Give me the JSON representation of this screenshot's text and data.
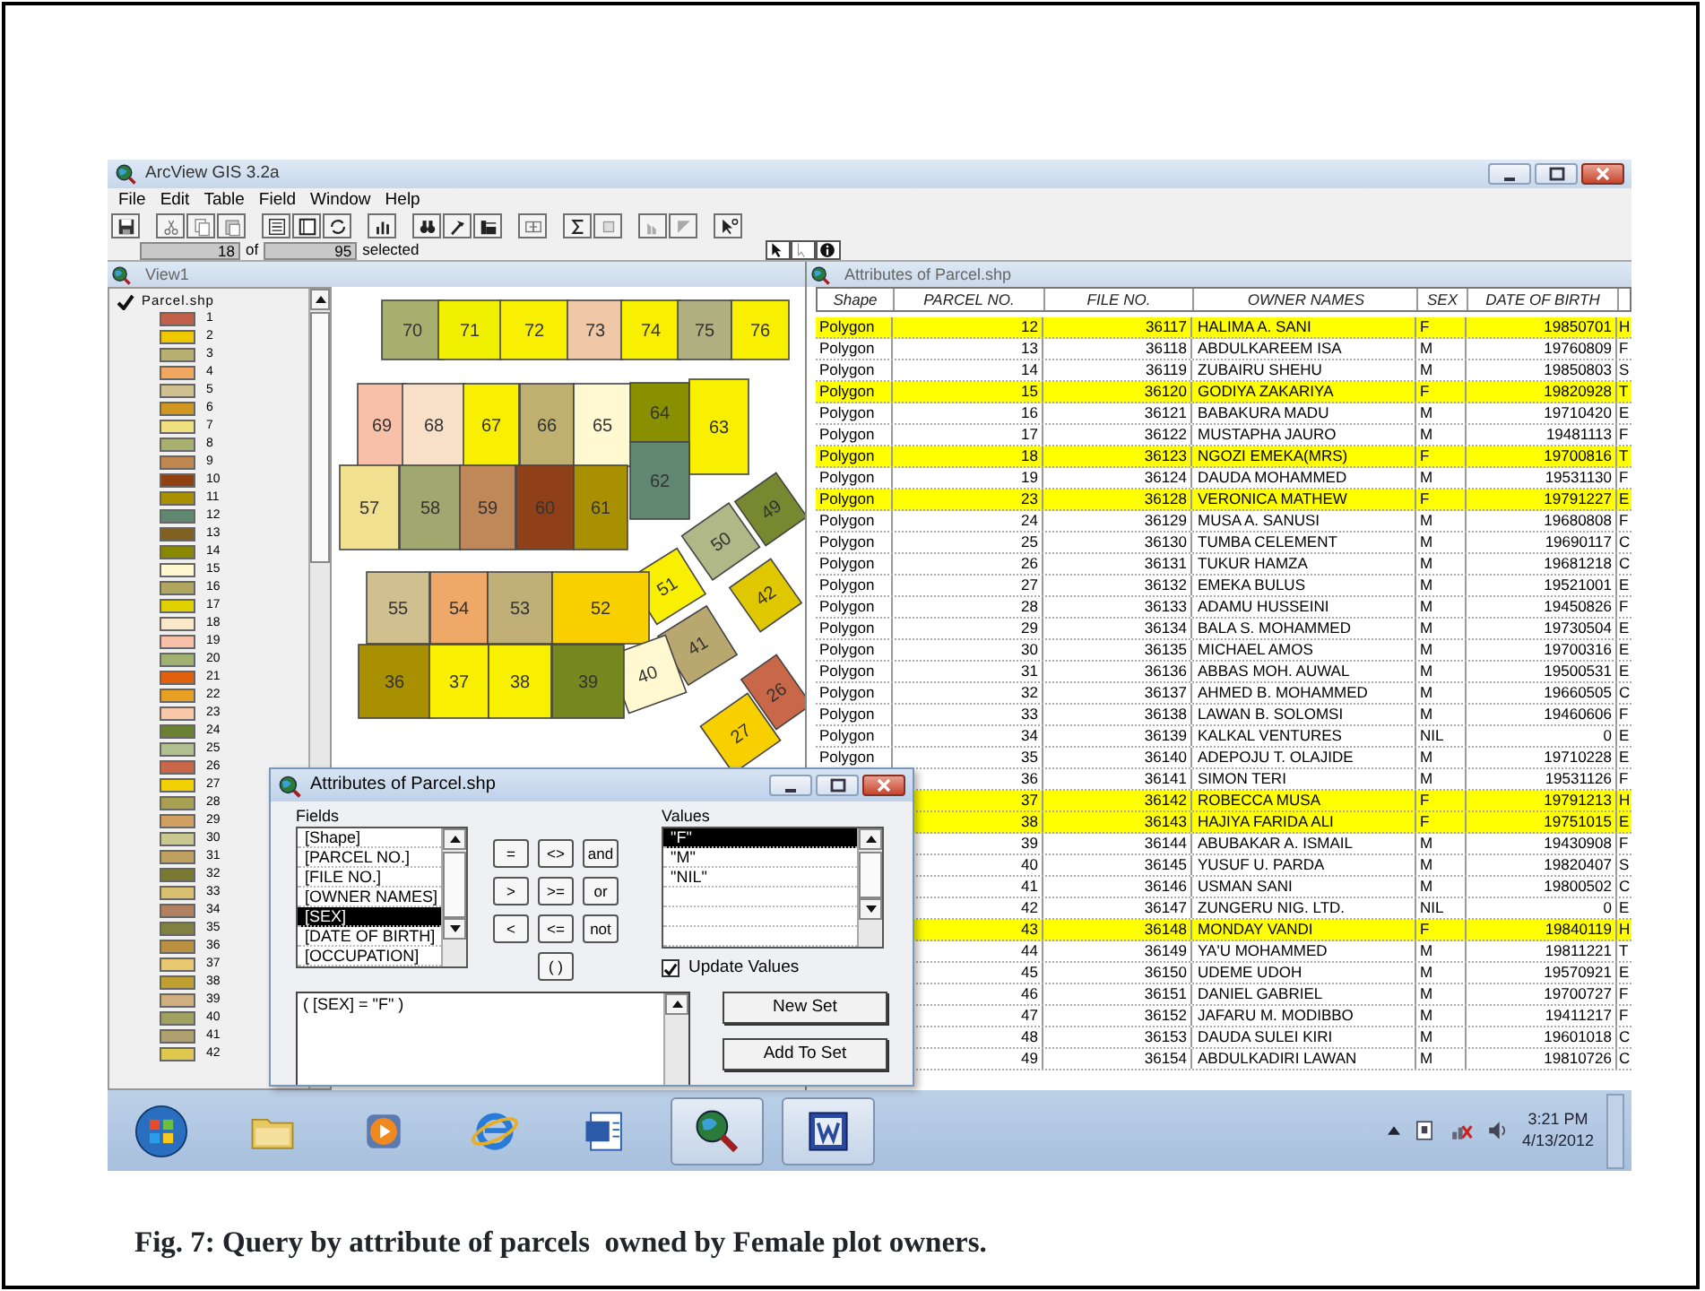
{
  "app": {
    "title": "ArcView GIS 3.2a"
  },
  "menu": [
    "File",
    "Edit",
    "Table",
    "Field",
    "Window",
    "Help"
  ],
  "selection": {
    "count": "18",
    "of_label": "of",
    "total": "95",
    "selected_label": "selected"
  },
  "view": {
    "title": "View1",
    "layer": {
      "name": "Parcel.shp",
      "visible": true,
      "legend": [
        {
          "label": "1",
          "color": "#c0604a"
        },
        {
          "label": "2",
          "color": "#f0c800"
        },
        {
          "label": "3",
          "color": "#b8b070"
        },
        {
          "label": "4",
          "color": "#f0a860"
        },
        {
          "label": "5",
          "color": "#d0c090"
        },
        {
          "label": "6",
          "color": "#d09820"
        },
        {
          "label": "7",
          "color": "#f0e080"
        },
        {
          "label": "8",
          "color": "#a8b070"
        },
        {
          "label": "9",
          "color": "#c08850"
        },
        {
          "label": "10",
          "color": "#904010"
        },
        {
          "label": "11",
          "color": "#a89000"
        },
        {
          "label": "12",
          "color": "#608870"
        },
        {
          "label": "13",
          "color": "#806020"
        },
        {
          "label": "14",
          "color": "#888800"
        },
        {
          "label": "15",
          "color": "#fff8d0"
        },
        {
          "label": "16",
          "color": "#b0a860"
        },
        {
          "label": "17",
          "color": "#e0d000"
        },
        {
          "label": "18",
          "color": "#f8e8c8"
        },
        {
          "label": "19",
          "color": "#f8c0a8"
        },
        {
          "label": "20",
          "color": "#a0b070"
        },
        {
          "label": "21",
          "color": "#e06010"
        },
        {
          "label": "22",
          "color": "#e8a020"
        },
        {
          "label": "23",
          "color": "#f8c8a8"
        },
        {
          "label": "24",
          "color": "#6a8030"
        },
        {
          "label": "25",
          "color": "#b0c090"
        },
        {
          "label": "26",
          "color": "#c86848"
        },
        {
          "label": "27",
          "color": "#f0d000"
        },
        {
          "label": "28",
          "color": "#a8a050"
        },
        {
          "label": "29",
          "color": "#d0a060"
        },
        {
          "label": "30",
          "color": "#c8c890"
        },
        {
          "label": "31",
          "color": "#c0a060"
        },
        {
          "label": "32",
          "color": "#787830"
        },
        {
          "label": "33",
          "color": "#d8c070"
        },
        {
          "label": "34",
          "color": "#b08060"
        },
        {
          "label": "35",
          "color": "#808040"
        },
        {
          "label": "36",
          "color": "#b89040"
        },
        {
          "label": "37",
          "color": "#e8c870"
        },
        {
          "label": "38",
          "color": "#c0a030"
        },
        {
          "label": "39",
          "color": "#d0b080"
        },
        {
          "label": "40",
          "color": "#a0a060"
        },
        {
          "label": "41",
          "color": "#b0a070"
        },
        {
          "label": "42",
          "color": "#e0c850"
        }
      ]
    },
    "parcels": [
      {
        "label": "70",
        "color": "#a8b070"
      },
      {
        "label": "71",
        "color": "#f0f000"
      },
      {
        "label": "72",
        "color": "#f8f000"
      },
      {
        "label": "73",
        "color": "#f0c8a8"
      },
      {
        "label": "74",
        "color": "#f8f000"
      },
      {
        "label": "75",
        "color": "#b0b080"
      },
      {
        "label": "76",
        "color": "#f8f000"
      },
      {
        "label": "69",
        "color": "#f8c0a8"
      },
      {
        "label": "68",
        "color": "#f8e0c8"
      },
      {
        "label": "67",
        "color": "#f8f000"
      },
      {
        "label": "66",
        "color": "#c0b070"
      },
      {
        "label": "65",
        "color": "#fff8d0"
      },
      {
        "label": "64",
        "color": "#889000"
      },
      {
        "label": "63",
        "color": "#f8f000"
      },
      {
        "label": "62",
        "color": "#608870"
      },
      {
        "label": "57",
        "color": "#f0e090"
      },
      {
        "label": "58",
        "color": "#a0a870"
      },
      {
        "label": "59",
        "color": "#c08858"
      },
      {
        "label": "60",
        "color": "#904018"
      },
      {
        "label": "61",
        "color": "#a89000"
      },
      {
        "label": "50",
        "color": "#b0b888"
      },
      {
        "label": "49",
        "color": "#788830"
      },
      {
        "label": "51",
        "color": "#f8f000"
      },
      {
        "label": "42",
        "color": "#e0c800"
      },
      {
        "label": "55",
        "color": "#d0c090"
      },
      {
        "label": "54",
        "color": "#f0a868"
      },
      {
        "label": "53",
        "color": "#c0b078"
      },
      {
        "label": "52",
        "color": "#f8d000"
      },
      {
        "label": "41",
        "color": "#b8a870"
      },
      {
        "label": "40",
        "color": "#fff8d0"
      },
      {
        "label": "27",
        "color": "#f8d000"
      },
      {
        "label": "26",
        "color": "#c86848"
      },
      {
        "label": "36",
        "color": "#a89000"
      },
      {
        "label": "37",
        "color": "#f8f000"
      },
      {
        "label": "38",
        "color": "#f8f000"
      },
      {
        "label": "39",
        "color": "#788820"
      }
    ]
  },
  "table_window": {
    "title": "Attributes of Parcel.shp",
    "columns": [
      "Shape",
      "PARCEL NO.",
      "FILE NO.",
      "OWNER NAMES",
      "SEX",
      "DATE OF BIRTH"
    ],
    "rows": [
      {
        "shape": "Polygon",
        "parcel_no": "12",
        "file_no": "36117",
        "owner": "HALIMA A. SANI",
        "sex": "F",
        "birth": "19850701",
        "column_7": "H",
        "selected": true
      },
      {
        "shape": "Polygon",
        "parcel_no": "13",
        "file_no": "36118",
        "owner": "ABDULKAREEM ISA",
        "sex": "M",
        "birth": "19760809",
        "column_7": "F",
        "selected": false
      },
      {
        "shape": "Polygon",
        "parcel_no": "14",
        "file_no": "36119",
        "owner": "ZUBAIRU SHEHU",
        "sex": "M",
        "birth": "19850803",
        "column_7": "S",
        "selected": false
      },
      {
        "shape": "Polygon",
        "parcel_no": "15",
        "file_no": "36120",
        "owner": "GODIYA ZAKARIYA",
        "sex": "F",
        "birth": "19820928",
        "column_7": "T",
        "selected": true
      },
      {
        "shape": "Polygon",
        "parcel_no": "16",
        "file_no": "36121",
        "owner": "BABAKURA MADU",
        "sex": "M",
        "birth": "19710420",
        "column_7": "E",
        "selected": false
      },
      {
        "shape": "Polygon",
        "parcel_no": "17",
        "file_no": "36122",
        "owner": "MUSTAPHA JAURO",
        "sex": "M",
        "birth": "19481113",
        "column_7": "F",
        "selected": false
      },
      {
        "shape": "Polygon",
        "parcel_no": "18",
        "file_no": "36123",
        "owner": "NGOZI EMEKA(MRS)",
        "sex": "F",
        "birth": "19700816",
        "column_7": "T",
        "selected": true
      },
      {
        "shape": "Polygon",
        "parcel_no": "19",
        "file_no": "36124",
        "owner": "DAUDA MOHAMMED",
        "sex": "M",
        "birth": "19531130",
        "column_7": "F",
        "selected": false
      },
      {
        "shape": "Polygon",
        "parcel_no": "23",
        "file_no": "36128",
        "owner": "VERONICA MATHEW",
        "sex": "F",
        "birth": "19791227",
        "column_7": "E",
        "selected": true
      },
      {
        "shape": "Polygon",
        "parcel_no": "24",
        "file_no": "36129",
        "owner": "MUSA A. SANUSI",
        "sex": "M",
        "birth": "19680808",
        "column_7": "F",
        "selected": false
      },
      {
        "shape": "Polygon",
        "parcel_no": "25",
        "file_no": "36130",
        "owner": "TUMBA CELEMENT",
        "sex": "M",
        "birth": "19690117",
        "column_7": "C",
        "selected": false
      },
      {
        "shape": "Polygon",
        "parcel_no": "26",
        "file_no": "36131",
        "owner": "TUKUR HAMZA",
        "sex": "M",
        "birth": "19681218",
        "column_7": "C",
        "selected": false
      },
      {
        "shape": "Polygon",
        "parcel_no": "27",
        "file_no": "36132",
        "owner": "EMEKA BULUS",
        "sex": "M",
        "birth": "19521001",
        "column_7": "E",
        "selected": false
      },
      {
        "shape": "Polygon",
        "parcel_no": "28",
        "file_no": "36133",
        "owner": "ADAMU HUSSEINI",
        "sex": "M",
        "birth": "19450826",
        "column_7": "F",
        "selected": false
      },
      {
        "shape": "Polygon",
        "parcel_no": "29",
        "file_no": "36134",
        "owner": "BALA S. MOHAMMED",
        "sex": "M",
        "birth": "19730504",
        "column_7": "E",
        "selected": false
      },
      {
        "shape": "Polygon",
        "parcel_no": "30",
        "file_no": "36135",
        "owner": "MICHAEL AMOS",
        "sex": "M",
        "birth": "19700316",
        "column_7": "E",
        "selected": false
      },
      {
        "shape": "Polygon",
        "parcel_no": "31",
        "file_no": "36136",
        "owner": "ABBAS MOH. AUWAL",
        "sex": "M",
        "birth": "19500531",
        "column_7": "E",
        "selected": false
      },
      {
        "shape": "Polygon",
        "parcel_no": "32",
        "file_no": "36137",
        "owner": "AHMED B. MOHAMMED",
        "sex": "M",
        "birth": "19660505",
        "column_7": "C",
        "selected": false
      },
      {
        "shape": "Polygon",
        "parcel_no": "33",
        "file_no": "36138",
        "owner": "LAWAN B. SOLOMSI",
        "sex": "M",
        "birth": "19460606",
        "column_7": "F",
        "selected": false
      },
      {
        "shape": "Polygon",
        "parcel_no": "34",
        "file_no": "36139",
        "owner": "KALKAL VENTURES",
        "sex": "NIL",
        "birth": "0",
        "column_7": "E",
        "selected": false
      },
      {
        "shape": "Polygon",
        "parcel_no": "35",
        "file_no": "36140",
        "owner": "ADEPOJU T. OLAJIDE",
        "sex": "M",
        "birth": "19710228",
        "column_7": "E",
        "selected": false
      },
      {
        "parcel_no": "36",
        "file_no": "36141",
        "owner": "SIMON TERI",
        "sex": "M",
        "birth": "19531126",
        "column_7": "F",
        "selected": false
      },
      {
        "parcel_no": "37",
        "file_no": "36142",
        "owner": "ROBECCA MUSA",
        "sex": "F",
        "birth": "19791213",
        "column_7": "H",
        "selected": true
      },
      {
        "parcel_no": "38",
        "file_no": "36143",
        "owner": "HAJIYA FARIDA ALI",
        "sex": "F",
        "birth": "19751015",
        "column_7": "E",
        "selected": true
      },
      {
        "parcel_no": "39",
        "file_no": "36144",
        "owner": "ABUBAKAR A. ISMAIL",
        "sex": "M",
        "birth": "19430908",
        "column_7": "F",
        "selected": false
      },
      {
        "parcel_no": "40",
        "file_no": "36145",
        "owner": "YUSUF U. PARDA",
        "sex": "M",
        "birth": "19820407",
        "column_7": "S",
        "selected": false
      },
      {
        "parcel_no": "41",
        "file_no": "36146",
        "owner": "USMAN SANI",
        "sex": "M",
        "birth": "19800502",
        "column_7": "C",
        "selected": false
      },
      {
        "parcel_no": "42",
        "file_no": "36147",
        "owner": "ZUNGERU NIG. LTD.",
        "sex": "NIL",
        "birth": "0",
        "column_7": "E",
        "selected": false
      },
      {
        "parcel_no": "43",
        "file_no": "36148",
        "owner": "MONDAY VANDI",
        "sex": "F",
        "birth": "19840119",
        "column_7": "H",
        "selected": true
      },
      {
        "parcel_no": "44",
        "file_no": "36149",
        "owner": "YA'U MOHAMMED",
        "sex": "M",
        "birth": "19811221",
        "column_7": "T",
        "selected": false
      },
      {
        "parcel_no": "45",
        "file_no": "36150",
        "owner": "UDEME UDOH",
        "sex": "M",
        "birth": "19570921",
        "column_7": "E",
        "selected": false
      },
      {
        "parcel_no": "46",
        "file_no": "36151",
        "owner": "DANIEL GABRIEL",
        "sex": "M",
        "birth": "19700727",
        "column_7": "F",
        "selected": false
      },
      {
        "parcel_no": "47",
        "file_no": "36152",
        "owner": "JAFARU M. MODIBBO",
        "sex": "M",
        "birth": "19411217",
        "column_7": "F",
        "selected": false
      },
      {
        "parcel_no": "48",
        "file_no": "36153",
        "owner": "DAUDA SULEI KIRI",
        "sex": "M",
        "birth": "19601018",
        "column_7": "C",
        "selected": false
      },
      {
        "parcel_no": "49",
        "file_no": "36154",
        "owner": "ABDULKADIRI LAWAN",
        "sex": "M",
        "birth": "19810726",
        "column_7": "C",
        "selected": false
      }
    ]
  },
  "query_dialog": {
    "title": "Attributes of Parcel.shp",
    "fields_label": "Fields",
    "fields": [
      {
        "label": "[Shape]",
        "selected": false
      },
      {
        "label": "[PARCEL NO.]",
        "selected": false
      },
      {
        "label": "[FILE NO.]",
        "selected": false
      },
      {
        "label": "[OWNER NAMES]",
        "selected": false
      },
      {
        "label": "[SEX]",
        "selected": true
      },
      {
        "label": "[DATE OF BIRTH]",
        "selected": false
      },
      {
        "label": "[OCCUPATION]",
        "selected": false
      }
    ],
    "operators": [
      "=",
      "<>",
      "and",
      ">",
      ">=",
      "or",
      "<",
      "<=",
      "not",
      "( )"
    ],
    "values_label": "Values",
    "values": [
      {
        "label": "\"F\"",
        "selected": true
      },
      {
        "label": "\"M\"",
        "selected": false
      },
      {
        "label": "\"NIL\"",
        "selected": false
      }
    ],
    "update_values": {
      "label": "Update Values",
      "checked": true
    },
    "expression": "( [SEX] = \"F\" )",
    "buttons": [
      "New Set",
      "Add To Set"
    ]
  },
  "taskbar": {
    "apps": [
      {
        "kind": "start",
        "active": false
      },
      {
        "kind": "folder",
        "active": false
      },
      {
        "kind": "media",
        "active": false
      },
      {
        "kind": "browser",
        "active": false
      },
      {
        "kind": "document",
        "active": false
      },
      {
        "kind": "globe",
        "active": true
      },
      {
        "kind": "word",
        "active": true
      }
    ],
    "clock": {
      "time": "3:21 PM",
      "date": "4/13/2012"
    }
  },
  "caption": "Fig. 7: Query by attribute of parcels  owned by Female plot owners."
}
